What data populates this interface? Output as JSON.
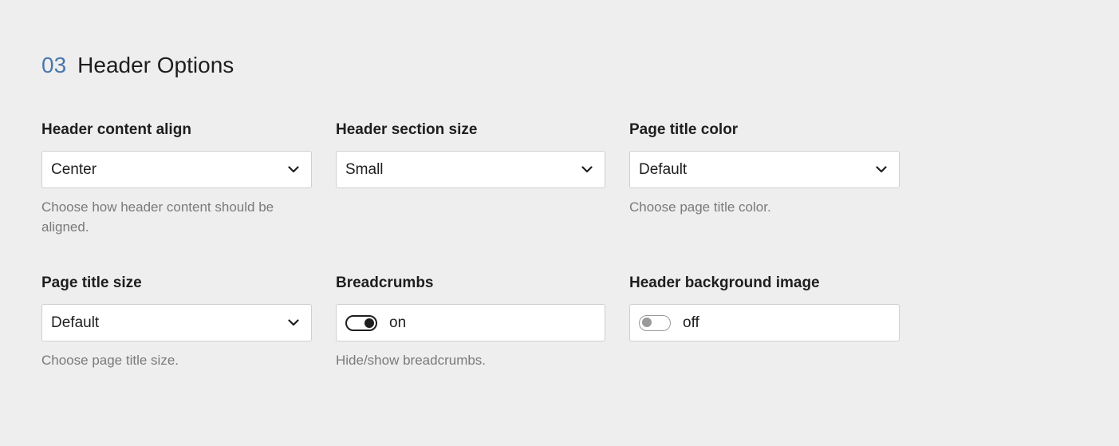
{
  "section": {
    "number": "03",
    "title": "Header Options"
  },
  "fields": {
    "header_content_align": {
      "label": "Header content align",
      "value": "Center",
      "help": "Choose how header content should be aligned."
    },
    "header_section_size": {
      "label": "Header section size",
      "value": "Small"
    },
    "page_title_color": {
      "label": "Page title color",
      "value": "Default",
      "help": "Choose page title color."
    },
    "page_title_size": {
      "label": "Page title size",
      "value": "Default",
      "help": "Choose page title size."
    },
    "breadcrumbs": {
      "label": "Breadcrumbs",
      "state": "on",
      "help": "Hide/show breadcrumbs."
    },
    "header_background_image": {
      "label": "Header background image",
      "state": "off"
    }
  },
  "icons": {
    "dropdown": "chevron-down-icon"
  },
  "colors": {
    "background": "#eeeeee",
    "accent_number": "#4a77ab",
    "text": "#1e1e1e",
    "help_text": "#7a7a7a",
    "border": "#cfcfcf"
  }
}
